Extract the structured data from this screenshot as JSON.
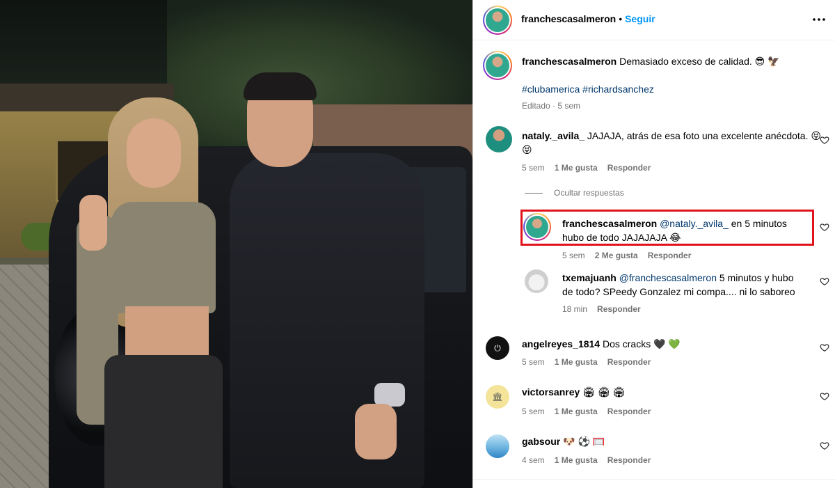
{
  "post": {
    "username": "franchescasalmeron",
    "follow_label": "Seguir",
    "more_icon": "more-options-icon",
    "caption_text": "Demasiado exceso de calidad. 😎 🦅",
    "hashtags": "#clubamerica #richardsanchez",
    "edited_meta": "Editado · 5 sem"
  },
  "comments": [
    {
      "username": "nataly._avila_",
      "text": "JAJAJA, atrás de esa foto una excelente anécdota. 😝 😝",
      "time": "5 sem",
      "likes": "1 Me gusta",
      "reply_label": "Responder"
    },
    {
      "username": "angelreyes_1814",
      "text": "Dos cracks 🖤 💚",
      "time": "5 sem",
      "likes": "1 Me gusta",
      "reply_label": "Responder"
    },
    {
      "username": "victorsanrey",
      "text": "🏟 🏟 🏟",
      "time": "5 sem",
      "likes": "1 Me gusta",
      "reply_label": "Responder"
    },
    {
      "username": "gabsour",
      "text": "🐶 ⚽ 🥅",
      "time": "4 sem",
      "likes": "1 Me gusta",
      "reply_label": "Responder"
    }
  ],
  "hide_replies_label": "Ocultar respuestas",
  "replies": [
    {
      "username": "franchescasalmeron",
      "mention": "@nataly._avila_",
      "text_line1": "en 5 minutos",
      "text_line2": "hubo de todo JAJAJAJA 😂",
      "time": "5 sem",
      "likes": "2 Me gusta",
      "reply_label": "Responder"
    },
    {
      "username": "txemajuanh",
      "mention": "@franchescasalmeron",
      "text_line1": "5 minutos y hubo",
      "text_line2": "de todo? SPeedy Gonzalez mi compa.... ni lo saboreo",
      "time": "18 min",
      "reply_label": "Responder"
    }
  ],
  "colors": {
    "link_blue": "#0095f6",
    "hashtag": "#00376b",
    "meta_gray": "#737373",
    "highlight_red": "#e0121b"
  }
}
